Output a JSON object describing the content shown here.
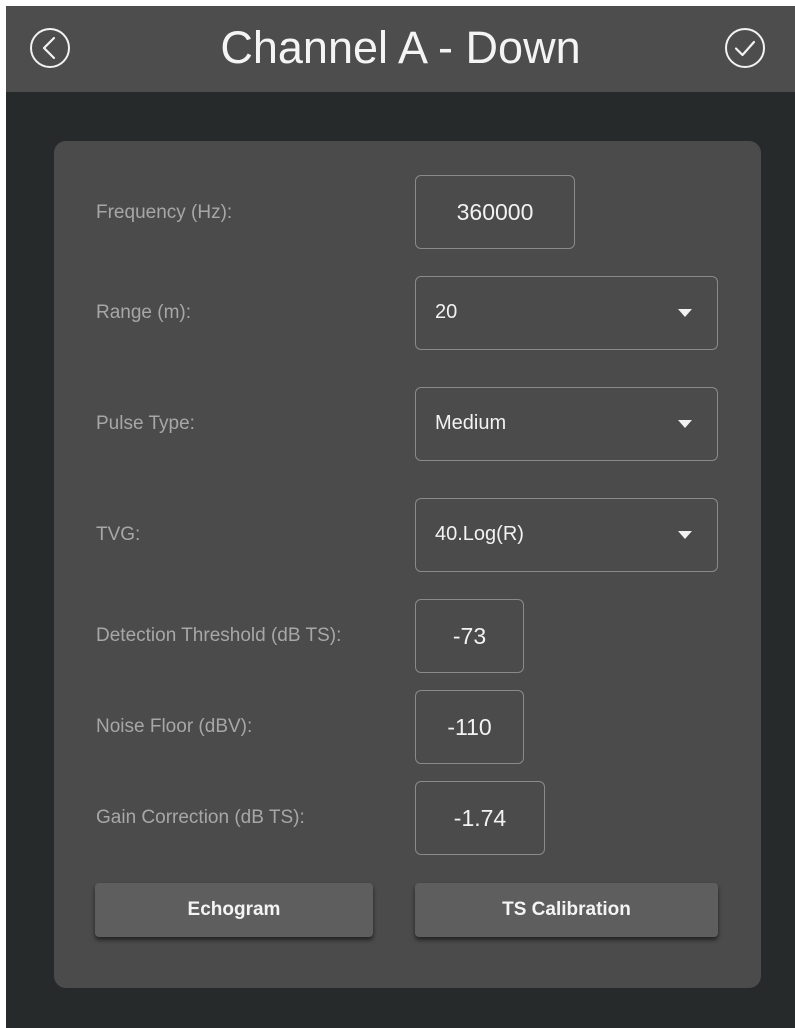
{
  "header": {
    "title": "Channel A - Down",
    "back_icon": "back-circle-icon",
    "confirm_icon": "check-circle-icon"
  },
  "form": {
    "frequency": {
      "label": "Frequency (Hz):",
      "value": "360000"
    },
    "range": {
      "label": "Range (m):",
      "value": "20"
    },
    "pulse_type": {
      "label": "Pulse Type:",
      "value": "Medium"
    },
    "tvg": {
      "label": "TVG:",
      "value": "40.Log(R)"
    },
    "detection_threshold": {
      "label": "Detection Threshold (dB TS):",
      "value": "-73"
    },
    "noise_floor": {
      "label": "Noise Floor (dBV):",
      "value": "-110"
    },
    "gain_correction": {
      "label": "Gain Correction (dB TS):",
      "value": "-1.74"
    }
  },
  "buttons": {
    "echogram": "Echogram",
    "ts_calibration": "TS Calibration"
  },
  "colors": {
    "page_background": "#262a2b",
    "header_background": "#4d4d4d",
    "panel_background": "#4b4b4b",
    "button_background": "#5e5e5e",
    "label_text": "#a7a7a7",
    "value_text": "#f2f2f2"
  }
}
